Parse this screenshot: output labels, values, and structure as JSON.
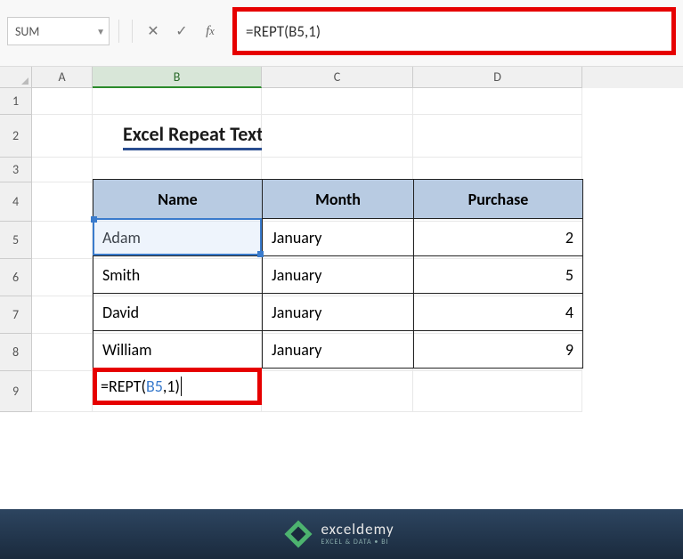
{
  "toolbar": {
    "name_box": "SUM",
    "formula": "=REPT(B5,1)"
  },
  "columns": [
    "A",
    "B",
    "C",
    "D"
  ],
  "rows": [
    "1",
    "2",
    "3",
    "4",
    "5",
    "6",
    "7",
    "8",
    "9"
  ],
  "title": "Excel Repeat Text Automatically",
  "table": {
    "headers": {
      "name": "Name",
      "month": "Month",
      "purchase": "Purchase"
    },
    "data": [
      {
        "name": "Adam",
        "month": "January",
        "purchase": "2"
      },
      {
        "name": "Smith",
        "month": "January",
        "purchase": "5"
      },
      {
        "name": "David",
        "month": "January",
        "purchase": "4"
      },
      {
        "name": "William",
        "month": "January",
        "purchase": "9"
      }
    ]
  },
  "edit": {
    "prefix": "=REPT(",
    "ref": "B5",
    "suffix": ",1)"
  },
  "footer": {
    "brand": "exceldemy",
    "sub": "EXCEL & DATA • BI"
  }
}
